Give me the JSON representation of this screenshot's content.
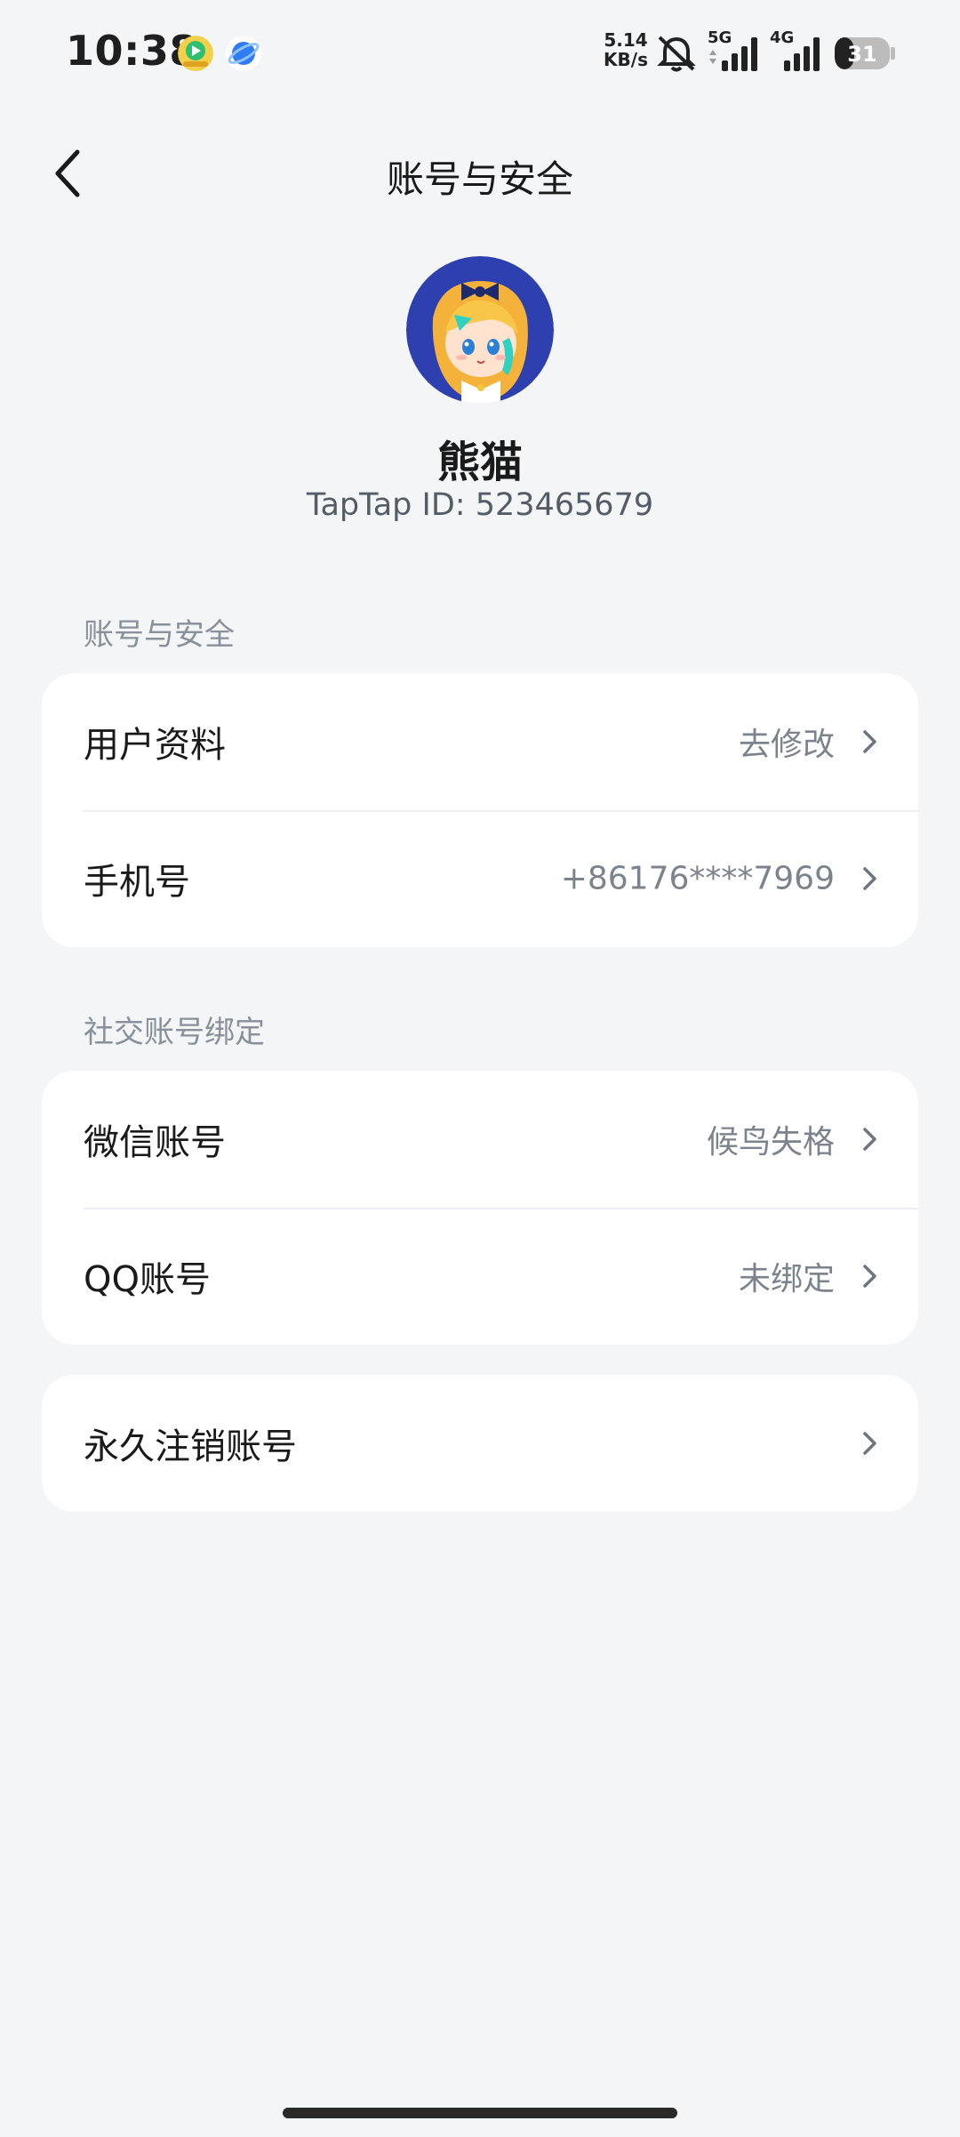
{
  "status_bar": {
    "time": "10:38",
    "net_speed_value": "5.14",
    "net_speed_unit": "KB/s",
    "network_5g": "5G",
    "network_4g": "4G",
    "battery_level": "31",
    "icons": [
      "video-app-icon",
      "browser-app-icon",
      "mute-icon",
      "signal-5g-icon",
      "signal-4g-icon",
      "battery-icon"
    ]
  },
  "header": {
    "title": "账号与安全",
    "back_icon": "chevron-left-icon"
  },
  "profile": {
    "name": "熊猫",
    "id_text": "TapTap ID: 523465679"
  },
  "account_section": {
    "label": "账号与安全",
    "items": [
      {
        "label": "用户资料",
        "value": "去修改"
      },
      {
        "label": "手机号",
        "value": "+86176****7969"
      }
    ]
  },
  "social_section": {
    "label": "社交账号绑定",
    "items": [
      {
        "label": "微信账号",
        "value": "候鸟失格"
      },
      {
        "label": "QQ账号",
        "value": "未绑定"
      }
    ]
  },
  "danger_section": {
    "items": [
      {
        "label": "永久注销账号"
      }
    ]
  },
  "colors": {
    "background": "#f4f5f7",
    "card": "#ffffff",
    "secondary_text": "#7d838c",
    "section_label": "#8a9099"
  }
}
